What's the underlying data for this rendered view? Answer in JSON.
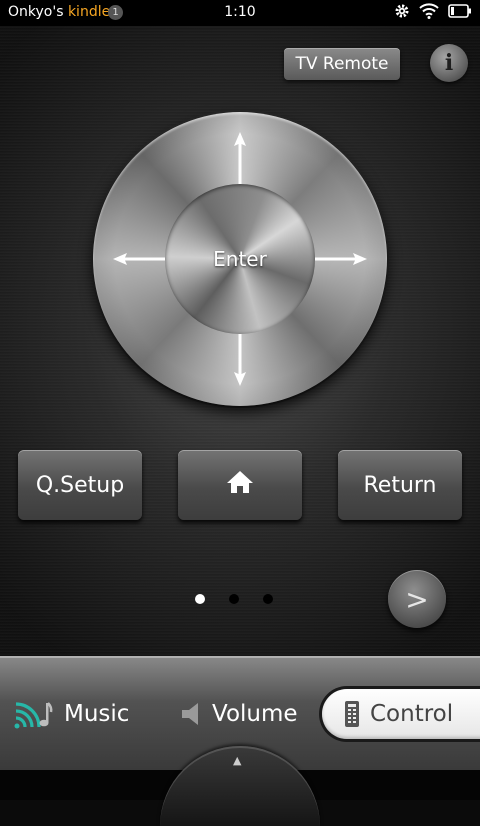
{
  "status_bar": {
    "owner": "Onkyo's",
    "brand": "kindle",
    "notification_count": "1",
    "time": "1:10",
    "icons": [
      "settings-gear-icon",
      "wifi-icon",
      "battery-icon"
    ]
  },
  "header": {
    "tv_remote_label": "TV Remote",
    "info_label": "i"
  },
  "dpad": {
    "center_label": "Enter",
    "arrows": [
      "up-arrow-icon",
      "down-arrow-icon",
      "left-arrow-icon",
      "right-arrow-icon"
    ]
  },
  "buttons": {
    "qsetup_label": "Q.Setup",
    "home_icon": "home-icon",
    "return_label": "Return"
  },
  "pager": {
    "page_count": 3,
    "active_page": 1,
    "next_label": ">"
  },
  "tabs": [
    {
      "label": "Music",
      "icon": "music-wifi-icon",
      "selected": false
    },
    {
      "label": "Volume",
      "icon": "speaker-icon",
      "selected": false
    },
    {
      "label": "Control",
      "icon": "remote-icon",
      "selected": true
    }
  ],
  "colors": {
    "brand_accent": "#f6a623",
    "music_icon": "#27b7a8"
  }
}
